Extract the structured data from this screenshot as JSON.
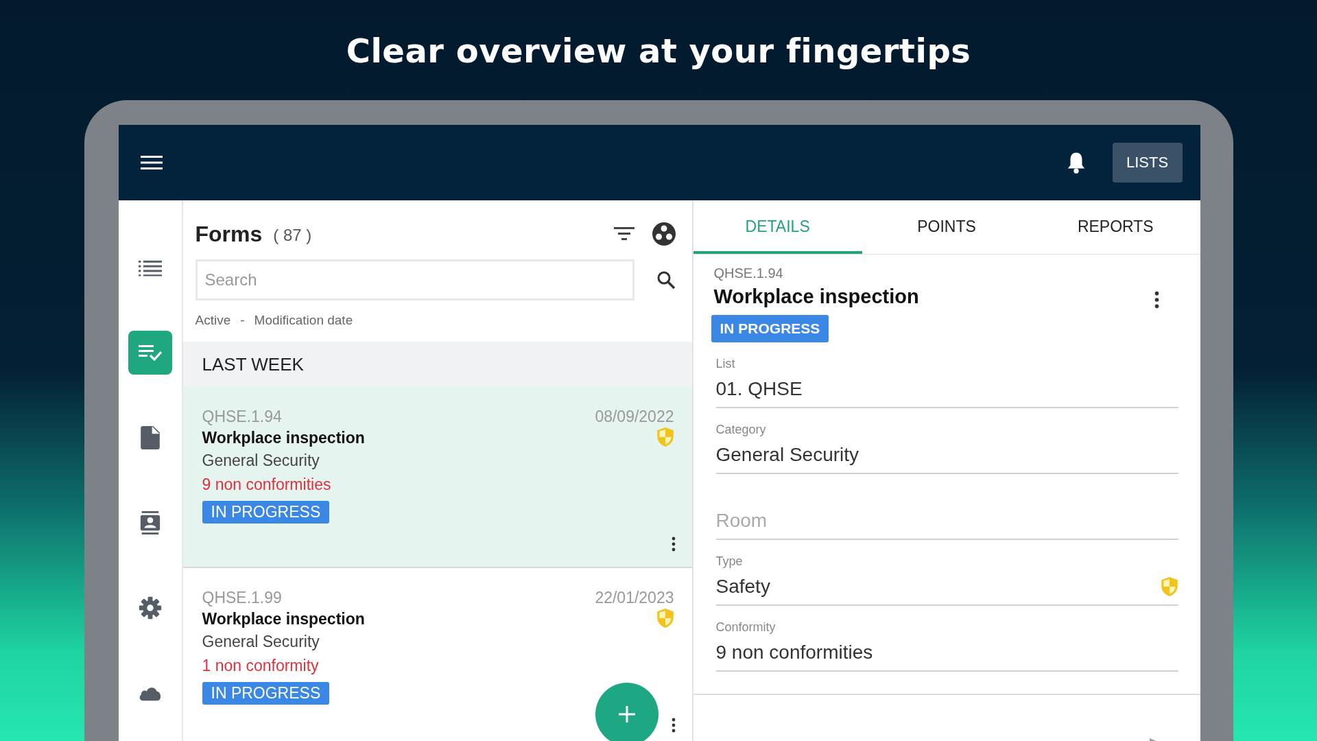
{
  "headline": "Clear overview at your fingertips",
  "toolbar": {
    "lists_button": "LISTS"
  },
  "rail": [
    {
      "kind": "list",
      "selected": false
    },
    {
      "kind": "checklist",
      "selected": true
    },
    {
      "kind": "document",
      "selected": false
    },
    {
      "kind": "contact",
      "selected": false
    },
    {
      "kind": "settings",
      "selected": false
    },
    {
      "kind": "cloud",
      "selected": false
    }
  ],
  "forms": {
    "title": "Forms",
    "count": "( 87 )",
    "search": {
      "placeholder": "Search"
    },
    "filter": [
      "Active",
      "-",
      "Modification date"
    ],
    "groups": [
      {
        "heading": "LAST WEEK",
        "items": [
          {
            "code": "QHSE.1.94",
            "date": "08/09/2022",
            "title": "Workplace inspection",
            "category": "General Security",
            "conformity": "9 non conformities",
            "status": "IN PROGRESS",
            "selected": true
          },
          {
            "code": "QHSE.1.99",
            "date": "22/01/2023",
            "title": "Workplace inspection",
            "category": "General Security",
            "conformity": "1 non conformity",
            "status": "IN PROGRESS",
            "selected": false
          }
        ]
      }
    ]
  },
  "tabs": [
    {
      "label": "DETAILS",
      "selected": true
    },
    {
      "label": "POINTS",
      "selected": false
    },
    {
      "label": "REPORTS",
      "selected": false
    }
  ],
  "details": {
    "code": "QHSE.1.94",
    "title": "Workplace inspection",
    "status": "IN PROGRESS",
    "fields": [
      {
        "kind": "value",
        "label": "List",
        "value": "01. QHSE"
      },
      {
        "kind": "value",
        "label": "Category",
        "value": "General Security"
      },
      {
        "kind": "placeholder",
        "placeholder": "Room"
      },
      {
        "kind": "flagged",
        "label": "Type",
        "value": "Safety"
      },
      {
        "kind": "value",
        "label": "Conformity",
        "value": "9 non conformities"
      }
    ]
  }
}
